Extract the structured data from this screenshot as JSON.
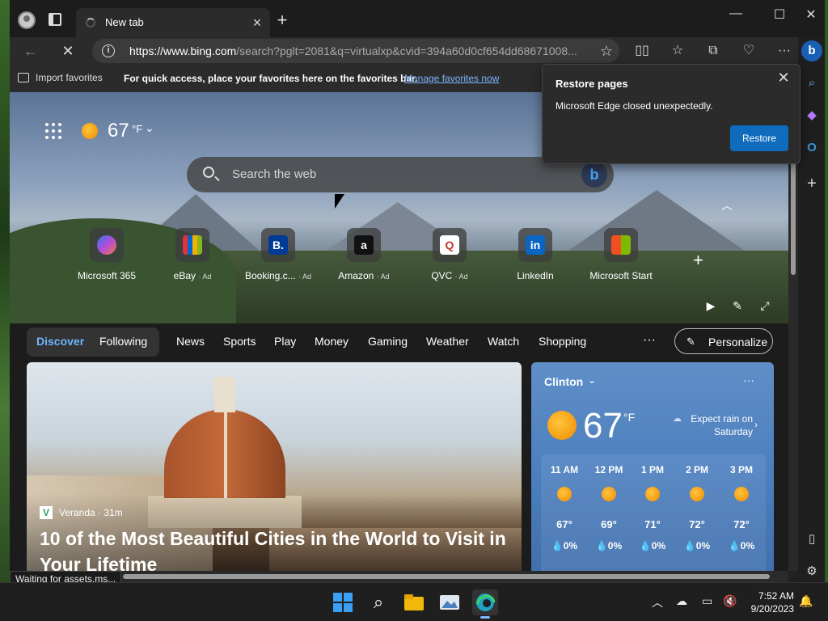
{
  "browser": {
    "tab_title": "New tab",
    "url_host": "https://www.bing.com",
    "url_rest": "/search?pglt=2081&q=virtualxp&cvid=394a60d0cf654dd68671008..."
  },
  "favorites_bar": {
    "import_label": "Import favorites",
    "hint": "For quick access, place your favorites here on the favorites bar.",
    "manage_link": "Manage favorites now"
  },
  "restore_popup": {
    "title": "Restore pages",
    "message": "Microsoft Edge closed unexpectedly.",
    "button": "Restore"
  },
  "hero": {
    "temperature": "67",
    "unit": "°F",
    "search_placeholder": "Search the web",
    "quick_links": [
      {
        "label": "Microsoft 365",
        "ad": ""
      },
      {
        "label": "eBay",
        "ad": "· Ad"
      },
      {
        "label": "Booking.c...",
        "ad": "· Ad"
      },
      {
        "label": "Amazon",
        "ad": "· Ad"
      },
      {
        "label": "QVC",
        "ad": "· Ad"
      },
      {
        "label": "LinkedIn",
        "ad": ""
      },
      {
        "label": "Microsoft Start",
        "ad": ""
      }
    ]
  },
  "feed_nav": {
    "tabs": [
      "Discover",
      "Following",
      "News",
      "Sports",
      "Play",
      "Money",
      "Gaming",
      "Weather",
      "Watch",
      "Shopping"
    ],
    "more": "···",
    "personalize": "Personalize"
  },
  "article": {
    "source": "Veranda · 31m",
    "headline": "10 of the Most Beautiful Cities in the World to Visit in Your Lifetime"
  },
  "weather_card": {
    "location": "Clinton",
    "temperature": "67",
    "unit": "°F",
    "note": "Expect rain on Saturday",
    "hours": [
      {
        "time": "11 AM",
        "temp": "67°",
        "rain": "💧0%"
      },
      {
        "time": "12 PM",
        "temp": "69°",
        "rain": "💧0%"
      },
      {
        "time": "1 PM",
        "temp": "71°",
        "rain": "💧0%"
      },
      {
        "time": "2 PM",
        "temp": "72°",
        "rain": "💧0%"
      },
      {
        "time": "3 PM",
        "temp": "72°",
        "rain": "💧0%"
      }
    ]
  },
  "status_text": "Waiting for assets.ms...",
  "taskbar": {
    "time": "7:52 AM",
    "date": "9/20/2023"
  },
  "colors": {
    "accent": "#0f6cbd",
    "active_tab": "#6cb6ff",
    "weather_card": "#4d7fbe"
  }
}
